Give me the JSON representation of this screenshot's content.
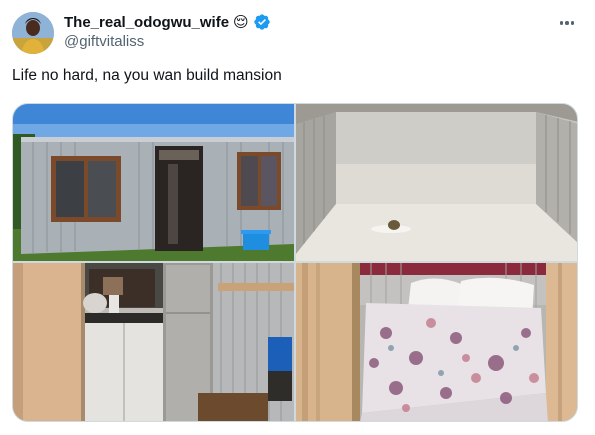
{
  "author": {
    "display_name": "The_real_odogwu_wife",
    "emoji": "😌",
    "handle": "@giftvitaliss",
    "verified": true,
    "verified_color": "#1d9bf0"
  },
  "tweet": {
    "text": "Life no hard, na you wan build mansion"
  },
  "media": {
    "images": [
      {
        "name": "corrugated-metal-shack-exterior"
      },
      {
        "name": "tiled-floor-interior"
      },
      {
        "name": "kitchen-with-fridge"
      },
      {
        "name": "bedroom-with-bed"
      }
    ]
  },
  "icons": {
    "more": "more-dots-icon",
    "verified": "verified-badge-icon"
  }
}
